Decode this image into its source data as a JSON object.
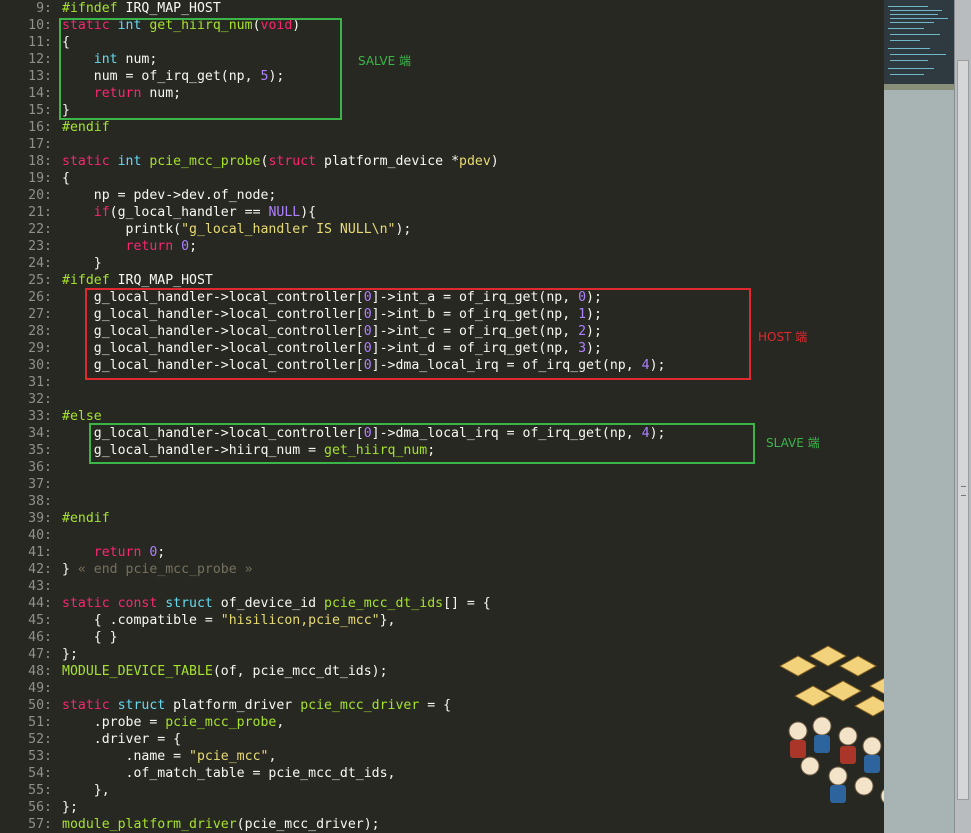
{
  "editor": {
    "first_line": 9,
    "lines": [
      [
        [
          "pp",
          "#ifndef "
        ],
        [
          "tx",
          "IRQ_MAP_HOST"
        ]
      ],
      [
        [
          "kw",
          "static "
        ],
        [
          "ty",
          "int "
        ],
        [
          "fn",
          "get_hiirq_num"
        ],
        [
          "tx",
          "("
        ],
        [
          "kw",
          "void"
        ],
        [
          "tx",
          ")"
        ]
      ],
      [
        [
          "tx",
          "{"
        ]
      ],
      [
        [
          "tx",
          "    "
        ],
        [
          "ty",
          "int "
        ],
        [
          "tx",
          "num;"
        ]
      ],
      [
        [
          "tx",
          "    num = of_irq_get(np, "
        ],
        [
          "num",
          "5"
        ],
        [
          "tx",
          ");"
        ]
      ],
      [
        [
          "tx",
          "    "
        ],
        [
          "kw",
          "return "
        ],
        [
          "tx",
          "num;"
        ]
      ],
      [
        [
          "tx",
          "}"
        ]
      ],
      [
        [
          "pp",
          "#endif"
        ]
      ],
      [],
      [
        [
          "kw",
          "static "
        ],
        [
          "ty",
          "int "
        ],
        [
          "fn",
          "pcie_mcc_probe"
        ],
        [
          "tx",
          "("
        ],
        [
          "kw",
          "struct "
        ],
        [
          "tx",
          "platform_device *"
        ],
        [
          "str",
          "pdev"
        ],
        [
          "tx",
          ")"
        ]
      ],
      [
        [
          "tx",
          "{"
        ]
      ],
      [
        [
          "tx",
          "    np = pdev->dev.of_node;"
        ]
      ],
      [
        [
          "tx",
          "    "
        ],
        [
          "kw",
          "if"
        ],
        [
          "tx",
          "(g_local_handler == "
        ],
        [
          "num",
          "NULL"
        ],
        [
          "tx",
          "){"
        ]
      ],
      [
        [
          "tx",
          "        printk("
        ],
        [
          "str",
          "\"g_local_handler IS NULL\\n\""
        ],
        [
          "tx",
          ");"
        ]
      ],
      [
        [
          "tx",
          "        "
        ],
        [
          "kw",
          "return "
        ],
        [
          "num",
          "0"
        ],
        [
          "tx",
          ";"
        ]
      ],
      [
        [
          "tx",
          "    }"
        ]
      ],
      [
        [
          "pp",
          "#ifdef "
        ],
        [
          "tx",
          "IRQ_MAP_HOST"
        ]
      ],
      [
        [
          "tx",
          "    g_local_handler->local_controller["
        ],
        [
          "num",
          "0"
        ],
        [
          "tx",
          "]->int_a = of_irq_get(np, "
        ],
        [
          "num",
          "0"
        ],
        [
          "tx",
          ");"
        ]
      ],
      [
        [
          "tx",
          "    g_local_handler->local_controller["
        ],
        [
          "num",
          "0"
        ],
        [
          "tx",
          "]->int_b = of_irq_get(np, "
        ],
        [
          "num",
          "1"
        ],
        [
          "tx",
          ");"
        ]
      ],
      [
        [
          "tx",
          "    g_local_handler->local_controller["
        ],
        [
          "num",
          "0"
        ],
        [
          "tx",
          "]->int_c = of_irq_get(np, "
        ],
        [
          "num",
          "2"
        ],
        [
          "tx",
          ");"
        ]
      ],
      [
        [
          "tx",
          "    g_local_handler->local_controller["
        ],
        [
          "num",
          "0"
        ],
        [
          "tx",
          "]->int_d = of_irq_get(np, "
        ],
        [
          "num",
          "3"
        ],
        [
          "tx",
          ");"
        ]
      ],
      [
        [
          "tx",
          "    g_local_handler->local_controller["
        ],
        [
          "num",
          "0"
        ],
        [
          "tx",
          "]->dma_local_irq = of_irq_get(np, "
        ],
        [
          "num",
          "4"
        ],
        [
          "tx",
          ");"
        ]
      ],
      [],
      [],
      [
        [
          "pp",
          "#else"
        ]
      ],
      [
        [
          "tx",
          "    g_local_handler->local_controller["
        ],
        [
          "num",
          "0"
        ],
        [
          "tx",
          "]->dma_local_irq = of_irq_get(np, "
        ],
        [
          "num",
          "4"
        ],
        [
          "tx",
          ");"
        ]
      ],
      [
        [
          "tx",
          "    g_local_handler->hiirq_num = "
        ],
        [
          "fn",
          "get_hiirq_num"
        ],
        [
          "tx",
          ";"
        ]
      ],
      [],
      [],
      [],
      [
        [
          "pp",
          "#endif"
        ]
      ],
      [],
      [
        [
          "tx",
          "    "
        ],
        [
          "kw",
          "return "
        ],
        [
          "num",
          "0"
        ],
        [
          "tx",
          ";"
        ]
      ],
      [
        [
          "tx",
          "} "
        ],
        [
          "cm",
          "« end pcie_mcc_probe »"
        ]
      ],
      [],
      [
        [
          "kw",
          "static const "
        ],
        [
          "ty",
          "struct "
        ],
        [
          "tx",
          "of_device_id "
        ],
        [
          "fn",
          "pcie_mcc_dt_ids"
        ],
        [
          "tx",
          "[] = {"
        ]
      ],
      [
        [
          "tx",
          "    { .compatible = "
        ],
        [
          "str",
          "\"hisilicon,pcie_mcc\""
        ],
        [
          "tx",
          "},"
        ]
      ],
      [
        [
          "tx",
          "    { }"
        ]
      ],
      [
        [
          "tx",
          "};"
        ]
      ],
      [
        [
          "fn",
          "MODULE_DEVICE_TABLE"
        ],
        [
          "tx",
          "(of, pcie_mcc_dt_ids);"
        ]
      ],
      [],
      [
        [
          "kw",
          "static "
        ],
        [
          "ty",
          "struct "
        ],
        [
          "tx",
          "platform_driver "
        ],
        [
          "fn",
          "pcie_mcc_driver"
        ],
        [
          "tx",
          " = {"
        ]
      ],
      [
        [
          "tx",
          "    .probe = "
        ],
        [
          "fn",
          "pcie_mcc_probe"
        ],
        [
          "tx",
          ","
        ]
      ],
      [
        [
          "tx",
          "    .driver = {"
        ]
      ],
      [
        [
          "tx",
          "        .name = "
        ],
        [
          "str",
          "\"pcie_mcc\""
        ],
        [
          "tx",
          ","
        ]
      ],
      [
        [
          "tx",
          "        .of_match_table = pcie_mcc_dt_ids,"
        ]
      ],
      [
        [
          "tx",
          "    },"
        ]
      ],
      [
        [
          "tx",
          "};"
        ]
      ],
      [
        [
          "fn",
          "module_platform_driver"
        ],
        [
          "tx",
          "(pcie_mcc_driver);"
        ]
      ]
    ]
  },
  "annotations": {
    "salve_label": "SALVE 端",
    "host_label": "HOST 端",
    "slave_label": "SLAVE 端"
  },
  "colors": {
    "green_box": "#3bb54a",
    "red_box": "#e0292f",
    "green_text": "#3bb54a",
    "red_text": "#e0292f"
  },
  "icons": {
    "sticker": "cartoon-crowd-sticker"
  }
}
